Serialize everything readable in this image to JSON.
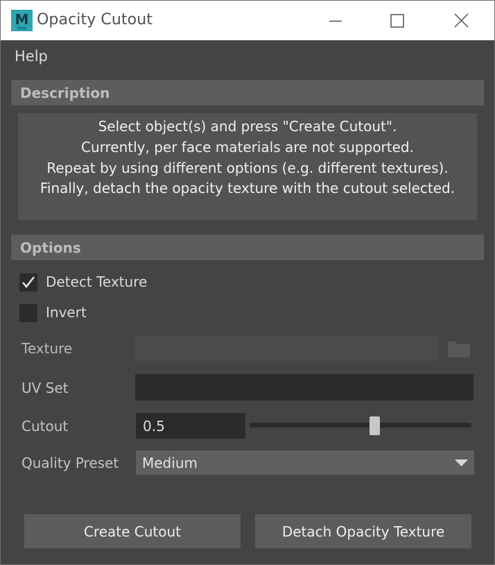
{
  "window": {
    "title": "Opacity Cutout",
    "app_icon": "maya-logo-icon",
    "app_icon_letter": "M",
    "app_icon_text": "MAYA",
    "controls": [
      "minimize-icon",
      "maximize-icon",
      "close-icon"
    ]
  },
  "menu": {
    "items": [
      {
        "label": "Help"
      }
    ]
  },
  "description": {
    "header": "Description",
    "lines": [
      "Select object(s) and press \"Create Cutout\".",
      "Currently, per face materials are not supported.",
      "Repeat by using different options (e.g. different textures).",
      "Finally, detach the opacity texture with the cutout selected."
    ]
  },
  "options": {
    "header": "Options",
    "detect_texture": {
      "label": "Detect Texture",
      "checked": true
    },
    "invert": {
      "label": "Invert",
      "checked": false
    },
    "texture": {
      "label": "Texture",
      "value": "",
      "enabled": false,
      "browse_icon": "folder-icon"
    },
    "uv_set": {
      "label": "UV Set",
      "value": ""
    },
    "cutout": {
      "label": "Cutout",
      "value": "0.5",
      "slider_fraction": 0.5
    },
    "quality_preset": {
      "label": "Quality Preset",
      "selected": "Medium"
    }
  },
  "buttons": {
    "create": "Create Cutout",
    "detach": "Detach Opacity Texture"
  },
  "colors": {
    "background": "#444444",
    "titlebar": "#ffffff",
    "section_header": "#5d5d5d",
    "field_dark": "#2b2b2b",
    "button": "#5c5c5c",
    "maya_icon": "#2fa6b1"
  }
}
